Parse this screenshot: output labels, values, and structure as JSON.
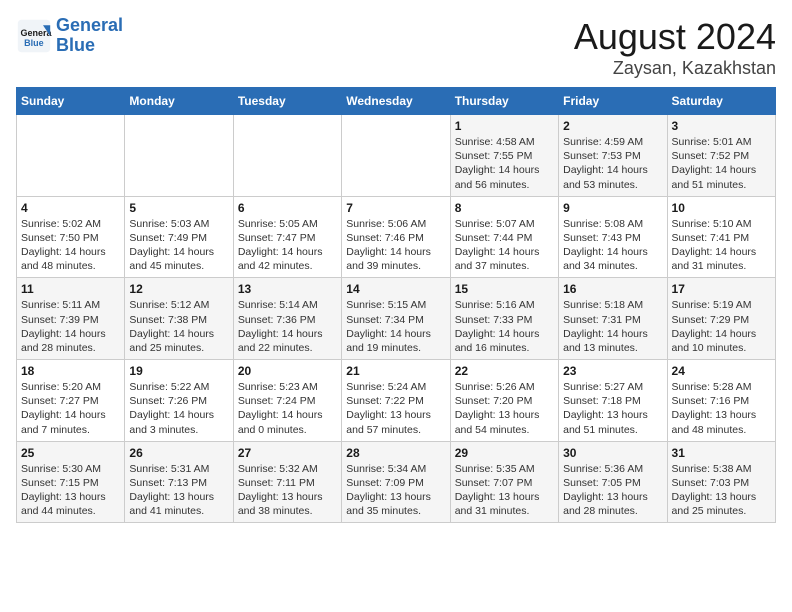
{
  "logo": {
    "line1": "General",
    "line2": "Blue"
  },
  "title": "August 2024",
  "subtitle": "Zaysan, Kazakhstan",
  "days_of_week": [
    "Sunday",
    "Monday",
    "Tuesday",
    "Wednesday",
    "Thursday",
    "Friday",
    "Saturday"
  ],
  "weeks": [
    [
      {
        "day": "",
        "info": ""
      },
      {
        "day": "",
        "info": ""
      },
      {
        "day": "",
        "info": ""
      },
      {
        "day": "",
        "info": ""
      },
      {
        "day": "1",
        "info": "Sunrise: 4:58 AM\nSunset: 7:55 PM\nDaylight: 14 hours\nand 56 minutes."
      },
      {
        "day": "2",
        "info": "Sunrise: 4:59 AM\nSunset: 7:53 PM\nDaylight: 14 hours\nand 53 minutes."
      },
      {
        "day": "3",
        "info": "Sunrise: 5:01 AM\nSunset: 7:52 PM\nDaylight: 14 hours\nand 51 minutes."
      }
    ],
    [
      {
        "day": "4",
        "info": "Sunrise: 5:02 AM\nSunset: 7:50 PM\nDaylight: 14 hours\nand 48 minutes."
      },
      {
        "day": "5",
        "info": "Sunrise: 5:03 AM\nSunset: 7:49 PM\nDaylight: 14 hours\nand 45 minutes."
      },
      {
        "day": "6",
        "info": "Sunrise: 5:05 AM\nSunset: 7:47 PM\nDaylight: 14 hours\nand 42 minutes."
      },
      {
        "day": "7",
        "info": "Sunrise: 5:06 AM\nSunset: 7:46 PM\nDaylight: 14 hours\nand 39 minutes."
      },
      {
        "day": "8",
        "info": "Sunrise: 5:07 AM\nSunset: 7:44 PM\nDaylight: 14 hours\nand 37 minutes."
      },
      {
        "day": "9",
        "info": "Sunrise: 5:08 AM\nSunset: 7:43 PM\nDaylight: 14 hours\nand 34 minutes."
      },
      {
        "day": "10",
        "info": "Sunrise: 5:10 AM\nSunset: 7:41 PM\nDaylight: 14 hours\nand 31 minutes."
      }
    ],
    [
      {
        "day": "11",
        "info": "Sunrise: 5:11 AM\nSunset: 7:39 PM\nDaylight: 14 hours\nand 28 minutes."
      },
      {
        "day": "12",
        "info": "Sunrise: 5:12 AM\nSunset: 7:38 PM\nDaylight: 14 hours\nand 25 minutes."
      },
      {
        "day": "13",
        "info": "Sunrise: 5:14 AM\nSunset: 7:36 PM\nDaylight: 14 hours\nand 22 minutes."
      },
      {
        "day": "14",
        "info": "Sunrise: 5:15 AM\nSunset: 7:34 PM\nDaylight: 14 hours\nand 19 minutes."
      },
      {
        "day": "15",
        "info": "Sunrise: 5:16 AM\nSunset: 7:33 PM\nDaylight: 14 hours\nand 16 minutes."
      },
      {
        "day": "16",
        "info": "Sunrise: 5:18 AM\nSunset: 7:31 PM\nDaylight: 14 hours\nand 13 minutes."
      },
      {
        "day": "17",
        "info": "Sunrise: 5:19 AM\nSunset: 7:29 PM\nDaylight: 14 hours\nand 10 minutes."
      }
    ],
    [
      {
        "day": "18",
        "info": "Sunrise: 5:20 AM\nSunset: 7:27 PM\nDaylight: 14 hours\nand 7 minutes."
      },
      {
        "day": "19",
        "info": "Sunrise: 5:22 AM\nSunset: 7:26 PM\nDaylight: 14 hours\nand 3 minutes."
      },
      {
        "day": "20",
        "info": "Sunrise: 5:23 AM\nSunset: 7:24 PM\nDaylight: 14 hours\nand 0 minutes."
      },
      {
        "day": "21",
        "info": "Sunrise: 5:24 AM\nSunset: 7:22 PM\nDaylight: 13 hours\nand 57 minutes."
      },
      {
        "day": "22",
        "info": "Sunrise: 5:26 AM\nSunset: 7:20 PM\nDaylight: 13 hours\nand 54 minutes."
      },
      {
        "day": "23",
        "info": "Sunrise: 5:27 AM\nSunset: 7:18 PM\nDaylight: 13 hours\nand 51 minutes."
      },
      {
        "day": "24",
        "info": "Sunrise: 5:28 AM\nSunset: 7:16 PM\nDaylight: 13 hours\nand 48 minutes."
      }
    ],
    [
      {
        "day": "25",
        "info": "Sunrise: 5:30 AM\nSunset: 7:15 PM\nDaylight: 13 hours\nand 44 minutes."
      },
      {
        "day": "26",
        "info": "Sunrise: 5:31 AM\nSunset: 7:13 PM\nDaylight: 13 hours\nand 41 minutes."
      },
      {
        "day": "27",
        "info": "Sunrise: 5:32 AM\nSunset: 7:11 PM\nDaylight: 13 hours\nand 38 minutes."
      },
      {
        "day": "28",
        "info": "Sunrise: 5:34 AM\nSunset: 7:09 PM\nDaylight: 13 hours\nand 35 minutes."
      },
      {
        "day": "29",
        "info": "Sunrise: 5:35 AM\nSunset: 7:07 PM\nDaylight: 13 hours\nand 31 minutes."
      },
      {
        "day": "30",
        "info": "Sunrise: 5:36 AM\nSunset: 7:05 PM\nDaylight: 13 hours\nand 28 minutes."
      },
      {
        "day": "31",
        "info": "Sunrise: 5:38 AM\nSunset: 7:03 PM\nDaylight: 13 hours\nand 25 minutes."
      }
    ]
  ]
}
